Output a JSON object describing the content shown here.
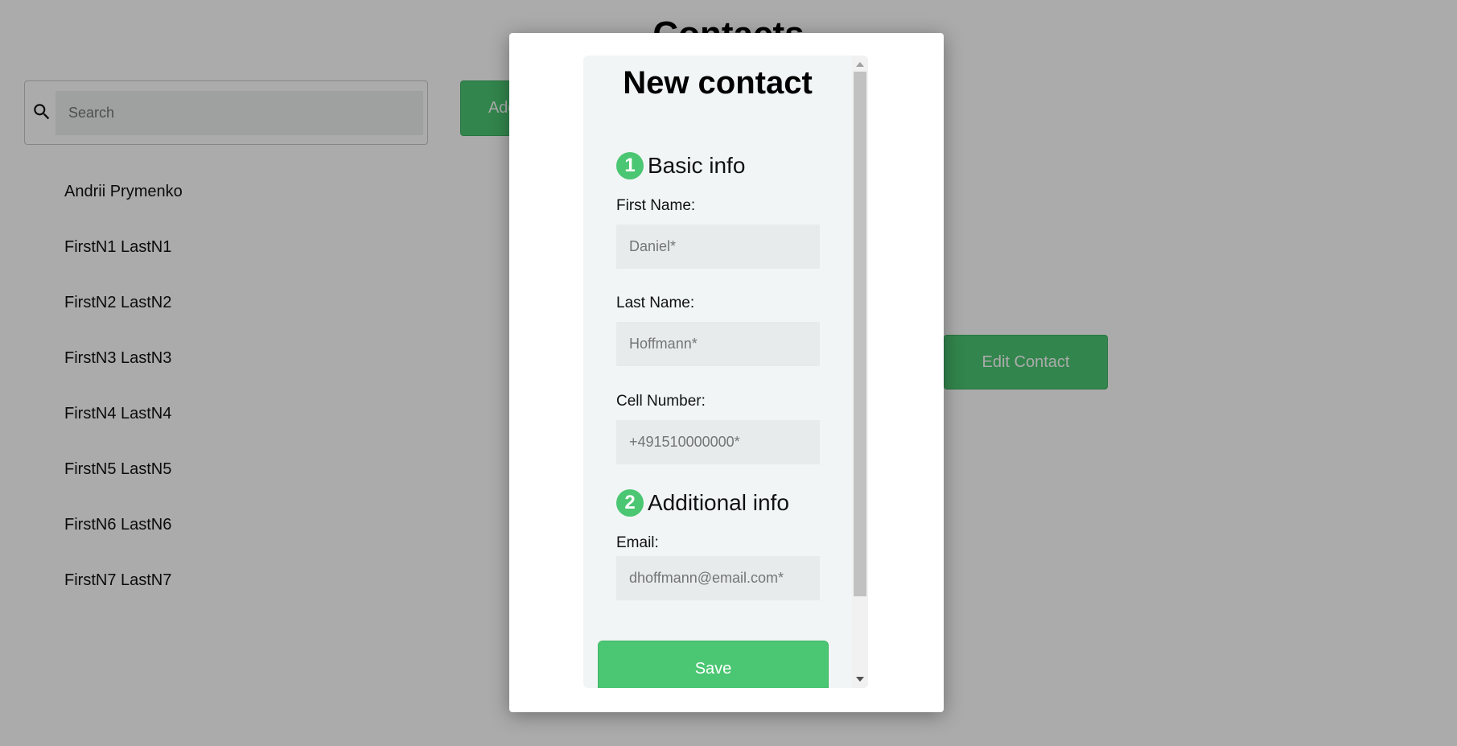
{
  "page": {
    "title": "Contacts"
  },
  "search": {
    "placeholder": "Search",
    "value": "",
    "icon": "search-icon"
  },
  "toolbar": {
    "add_label": "Add Contact",
    "edit_label": "Edit Contact"
  },
  "contacts": [
    "Andrii Prymenko",
    "FirstN1 LastN1",
    "FirstN2 LastN2",
    "FirstN3 LastN3",
    "FirstN4 LastN4",
    "FirstN5 LastN5",
    "FirstN6 LastN6",
    "FirstN7 LastN7"
  ],
  "modal": {
    "title": "New contact",
    "sections": [
      {
        "number": "1",
        "title": "Basic info"
      },
      {
        "number": "2",
        "title": "Additional info"
      }
    ],
    "fields": {
      "first_name": {
        "label": "First Name:",
        "placeholder": "Daniel*",
        "value": ""
      },
      "last_name": {
        "label": "Last Name:",
        "placeholder": "Hoffmann*",
        "value": ""
      },
      "cell_number": {
        "label": "Cell Number:",
        "placeholder": "+491510000000*",
        "value": ""
      },
      "email": {
        "label": "Email:",
        "placeholder": "dhoffmann@email.com*",
        "value": ""
      }
    },
    "save_label": "Save"
  },
  "colors": {
    "accent": "#4bc672",
    "overlay": "#000000",
    "form_background": "#f1f5f5",
    "input_background": "#e7ebeb"
  }
}
